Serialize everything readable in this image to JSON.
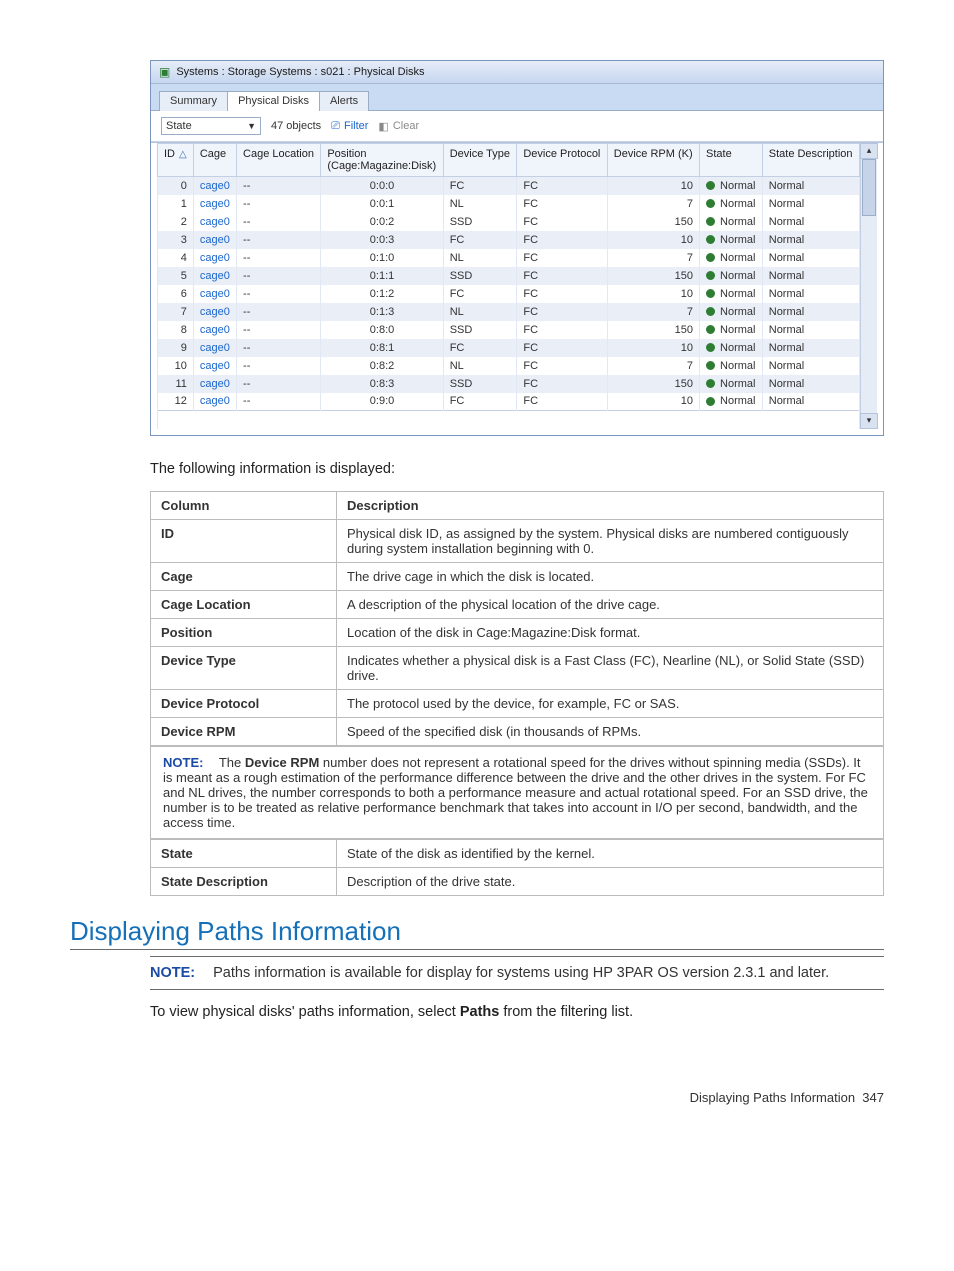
{
  "app": {
    "title": "Systems : Storage Systems : s021 : Physical Disks",
    "tabs": [
      "Summary",
      "Physical Disks",
      "Alerts"
    ],
    "activeTab": 1,
    "toolbar": {
      "stateLabel": "State",
      "count": "47 objects",
      "filterLabel": "Filter",
      "clearLabel": "Clear"
    },
    "columns": {
      "id": "ID",
      "cage": "Cage",
      "cageLocation": "Cage Location",
      "position": "Position",
      "positionSub": "(Cage:Magazine:Disk)",
      "deviceType": "Device Type",
      "deviceProtocol": "Device Protocol",
      "deviceRpm": "Device RPM (K)",
      "state": "State",
      "stateDesc": "State Description"
    },
    "rows": [
      {
        "id": "0",
        "cage": "cage0",
        "cageLocation": "--",
        "position": "0:0:0",
        "deviceType": "FC",
        "deviceProtocol": "FC",
        "rpm": "10",
        "state": "Normal",
        "stateDesc": "Normal",
        "alt": true
      },
      {
        "id": "1",
        "cage": "cage0",
        "cageLocation": "--",
        "position": "0:0:1",
        "deviceType": "NL",
        "deviceProtocol": "FC",
        "rpm": "7",
        "state": "Normal",
        "stateDesc": "Normal",
        "alt": false
      },
      {
        "id": "2",
        "cage": "cage0",
        "cageLocation": "--",
        "position": "0:0:2",
        "deviceType": "SSD",
        "deviceProtocol": "FC",
        "rpm": "150",
        "state": "Normal",
        "stateDesc": "Normal",
        "alt": false
      },
      {
        "id": "3",
        "cage": "cage0",
        "cageLocation": "--",
        "position": "0:0:3",
        "deviceType": "FC",
        "deviceProtocol": "FC",
        "rpm": "10",
        "state": "Normal",
        "stateDesc": "Normal",
        "alt": true
      },
      {
        "id": "4",
        "cage": "cage0",
        "cageLocation": "--",
        "position": "0:1:0",
        "deviceType": "NL",
        "deviceProtocol": "FC",
        "rpm": "7",
        "state": "Normal",
        "stateDesc": "Normal",
        "alt": false
      },
      {
        "id": "5",
        "cage": "cage0",
        "cageLocation": "--",
        "position": "0:1:1",
        "deviceType": "SSD",
        "deviceProtocol": "FC",
        "rpm": "150",
        "state": "Normal",
        "stateDesc": "Normal",
        "alt": true
      },
      {
        "id": "6",
        "cage": "cage0",
        "cageLocation": "--",
        "position": "0:1:2",
        "deviceType": "FC",
        "deviceProtocol": "FC",
        "rpm": "10",
        "state": "Normal",
        "stateDesc": "Normal",
        "alt": false
      },
      {
        "id": "7",
        "cage": "cage0",
        "cageLocation": "--",
        "position": "0:1:3",
        "deviceType": "NL",
        "deviceProtocol": "FC",
        "rpm": "7",
        "state": "Normal",
        "stateDesc": "Normal",
        "alt": true
      },
      {
        "id": "8",
        "cage": "cage0",
        "cageLocation": "--",
        "position": "0:8:0",
        "deviceType": "SSD",
        "deviceProtocol": "FC",
        "rpm": "150",
        "state": "Normal",
        "stateDesc": "Normal",
        "alt": false
      },
      {
        "id": "9",
        "cage": "cage0",
        "cageLocation": "--",
        "position": "0:8:1",
        "deviceType": "FC",
        "deviceProtocol": "FC",
        "rpm": "10",
        "state": "Normal",
        "stateDesc": "Normal",
        "alt": true
      },
      {
        "id": "10",
        "cage": "cage0",
        "cageLocation": "--",
        "position": "0:8:2",
        "deviceType": "NL",
        "deviceProtocol": "FC",
        "rpm": "7",
        "state": "Normal",
        "stateDesc": "Normal",
        "alt": false
      },
      {
        "id": "11",
        "cage": "cage0",
        "cageLocation": "--",
        "position": "0:8:3",
        "deviceType": "SSD",
        "deviceProtocol": "FC",
        "rpm": "150",
        "state": "Normal",
        "stateDesc": "Normal",
        "alt": true
      },
      {
        "id": "12",
        "cage": "cage0",
        "cageLocation": "--",
        "position": "0:9:0",
        "deviceType": "FC",
        "deviceProtocol": "FC",
        "rpm": "10",
        "state": "Normal",
        "stateDesc": "Normal",
        "alt": false
      }
    ]
  },
  "intro": "The following information is displayed:",
  "descTable": {
    "headColumn": "Column",
    "headDesc": "Description",
    "rows": [
      [
        "ID",
        "Physical disk ID, as assigned by the system. Physical disks are numbered contiguously during system installation beginning with 0."
      ],
      [
        "Cage",
        "The drive cage in which the disk is located."
      ],
      [
        "Cage Location",
        "A description of the physical location of the drive cage."
      ],
      [
        "Position",
        "Location of the disk in Cage:Magazine:Disk format."
      ],
      [
        "Device Type",
        "Indicates whether a physical disk is a Fast Class (FC), Nearline (NL), or Solid State (SSD) drive."
      ],
      [
        "Device Protocol",
        "The protocol used by the device, for example, FC or SAS."
      ],
      [
        "Device RPM",
        "Speed of the specified disk (in thousands of RPMs."
      ]
    ]
  },
  "note1": {
    "label": "NOTE:",
    "textPrefix": "The ",
    "bold": "Device RPM",
    "textSuffix": " number does not represent a rotational speed for the drives without spinning media (SSDs). It is meant as a rough estimation of the performance difference between the drive and the other drives in the system. For FC and NL drives, the number corresponds to both a performance measure and actual rotational speed. For an SSD drive, the number is to be treated as relative performance benchmark that takes into account in I/O per second, bandwidth, and the access time."
  },
  "descTable2": {
    "rows": [
      [
        "State",
        "State of the disk as identified by the kernel."
      ],
      [
        "State Description",
        "Description of the drive state."
      ]
    ]
  },
  "section": {
    "title": "Displaying Paths Information",
    "note": {
      "label": "NOTE:",
      "text": "Paths information is available for display for systems using HP 3PAR OS version 2.3.1 and later."
    },
    "body": {
      "prefix": "To view physical disks' paths information, select ",
      "bold": "Paths",
      "suffix": " from the filtering list."
    }
  },
  "footer": {
    "text": "Displaying Paths Information",
    "page": "347"
  }
}
